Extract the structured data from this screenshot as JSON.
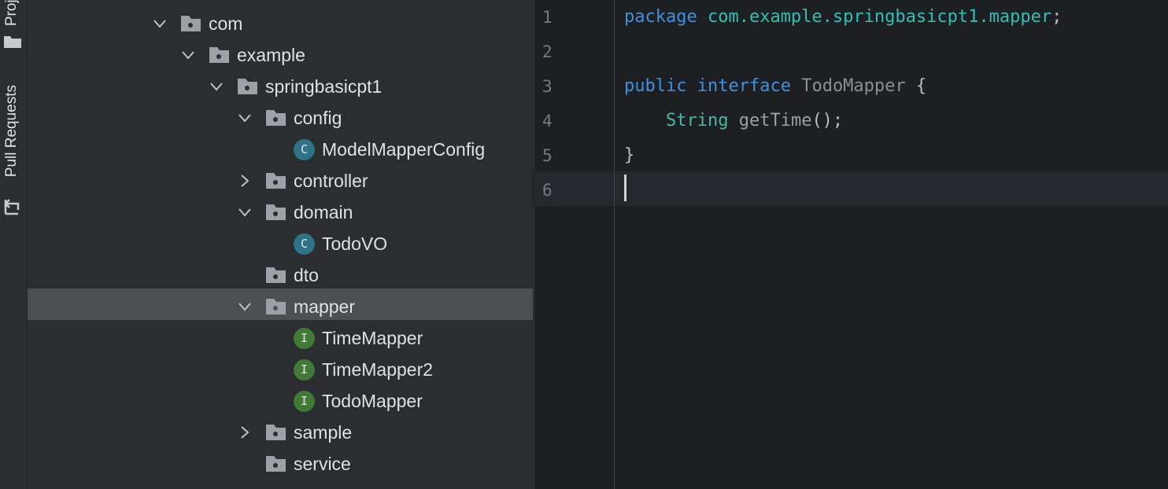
{
  "toolstrip": {
    "project_label": "Project",
    "pull_requests_label": "Pull Requests"
  },
  "tree": [
    {
      "label": "com",
      "type": "package",
      "expanded": true
    },
    {
      "label": "example",
      "type": "package",
      "expanded": true
    },
    {
      "label": "springbasicpt1",
      "type": "package",
      "expanded": true
    },
    {
      "label": "config",
      "type": "package",
      "expanded": true
    },
    {
      "label": "ModelMapperConfig",
      "type": "class",
      "badge": "C"
    },
    {
      "label": "controller",
      "type": "package",
      "expanded": false
    },
    {
      "label": "domain",
      "type": "package",
      "expanded": true
    },
    {
      "label": "TodoVO",
      "type": "class",
      "badge": "C"
    },
    {
      "label": "dto",
      "type": "package"
    },
    {
      "label": "mapper",
      "type": "package",
      "expanded": true,
      "selected": true
    },
    {
      "label": "TimeMapper",
      "type": "interface",
      "badge": "I"
    },
    {
      "label": "TimeMapper2",
      "type": "interface",
      "badge": "I"
    },
    {
      "label": "TodoMapper",
      "type": "interface",
      "badge": "I"
    },
    {
      "label": "sample",
      "type": "package",
      "expanded": false
    },
    {
      "label": "service",
      "type": "package"
    }
  ],
  "editor": {
    "line_numbers": [
      "1",
      "2",
      "3",
      "4",
      "5",
      "6"
    ],
    "code": {
      "l1_kw": "package",
      "l1_pkg": "com.example.springbasicpt1.mapper",
      "l1_end": ";",
      "l3_kw1": "public",
      "l3_kw2": "interface",
      "l3_name": "TodoMapper",
      "l3_brace": "{",
      "l4_type": "String",
      "l4_fn": "getTime",
      "l4_end": "();",
      "l5_brace": "}"
    },
    "current_line": "6"
  },
  "colors": {
    "keyword": "#3f92e0",
    "package_name": "#2fc1b6",
    "type": "#4bb8a2",
    "class_badge": "#2f7386",
    "interface_badge": "#3f7a36",
    "selection": "#4e4f51"
  }
}
